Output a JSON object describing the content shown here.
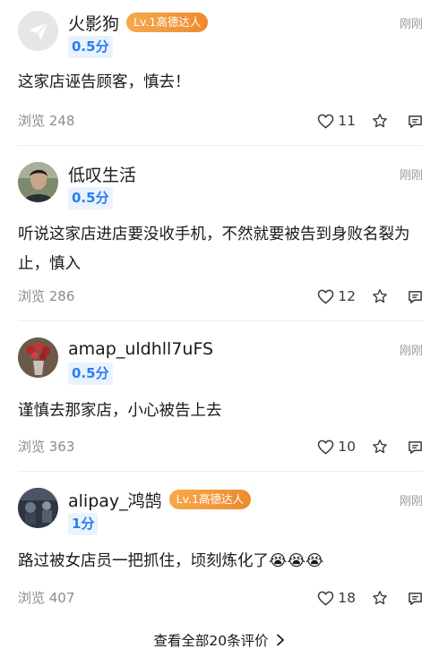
{
  "reviews": [
    {
      "username": "火影狗",
      "badge": "Lv.1高德达人",
      "score": "0.5分",
      "time": "刚刚",
      "content": "这家店诬告顾客，慎去！",
      "views": "浏览 248",
      "likes": "11",
      "avatar": "send-icon"
    },
    {
      "username": "低叹生活",
      "badge": "",
      "score": "0.5分",
      "time": "刚刚",
      "content": "听说这家店进店要没收手机，不然就要被告到身败名裂为止，慎入",
      "views": "浏览 286",
      "likes": "12",
      "avatar": "person-photo"
    },
    {
      "username": "amap_uldhll7uFS",
      "badge": "",
      "score": "0.5分",
      "time": "刚刚",
      "content": "谨慎去那家店，小心被告上去",
      "views": "浏览 363",
      "likes": "10",
      "avatar": "flowers-photo"
    },
    {
      "username": "alipay_鸿鹄",
      "badge": "Lv.1高德达人",
      "score": "1分",
      "time": "刚刚",
      "content": "路过被女店员一把抓住，顷刻炼化了😭😭😭",
      "views": "浏览 407",
      "likes": "18",
      "avatar": "dark-photo"
    }
  ],
  "view_all": "查看全部20条评价",
  "colors": {
    "accent": "#2a7ef0",
    "badge": "#f09232"
  }
}
